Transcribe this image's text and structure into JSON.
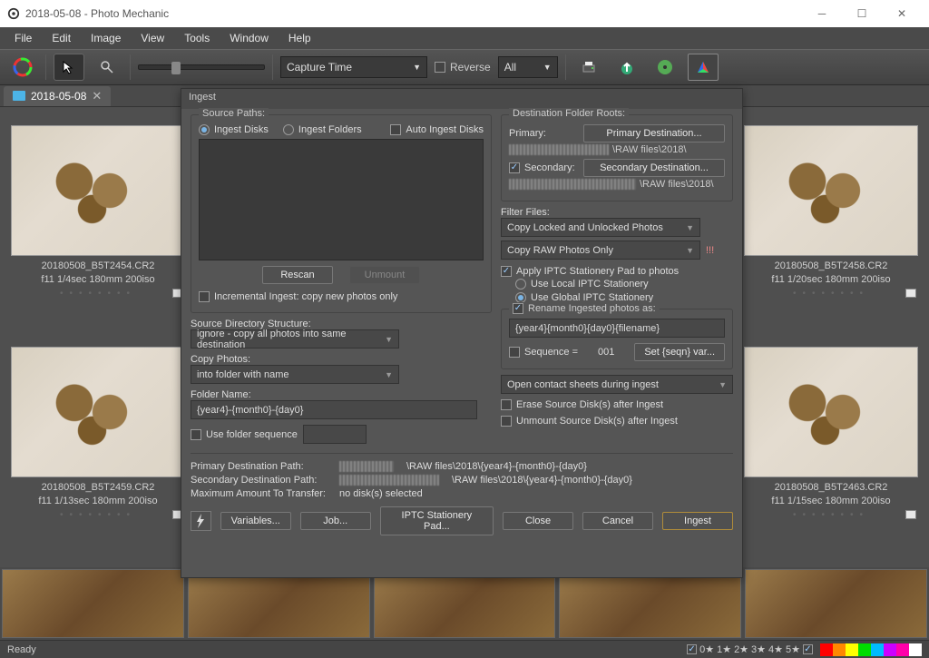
{
  "window": {
    "title": "2018-05-08 - Photo Mechanic"
  },
  "menu": [
    "File",
    "Edit",
    "Image",
    "View",
    "Tools",
    "Window",
    "Help"
  ],
  "toolbar": {
    "capture_sort": "Capture Time",
    "reverse": "Reverse",
    "filter": "All"
  },
  "tab": {
    "label": "2018-05-08"
  },
  "thumbs": [
    {
      "file": "20180508_B5T2454.CR2",
      "meta": "f11 1/4sec 180mm 200iso"
    },
    {
      "file": "20180508_B5T2458.CR2",
      "meta": "f11 1/20sec 180mm 200iso"
    },
    {
      "file": "20180508_B5T2459.CR2",
      "meta": "f11 1/13sec 180mm 200iso"
    },
    {
      "file": "20180508_B5T2463.CR2",
      "meta": "f11 1/15sec 180mm 200iso"
    }
  ],
  "dialog": {
    "title": "Ingest",
    "source": {
      "legend": "Source Paths:",
      "radio_disks": "Ingest Disks",
      "radio_folders": "Ingest Folders",
      "auto": "Auto Ingest Disks",
      "rescan": "Rescan",
      "unmount": "Unmount",
      "incremental": "Incremental Ingest: copy new photos only"
    },
    "dirstruct": {
      "label": "Source Directory Structure:",
      "value": "ignore - copy all photos into same destination"
    },
    "copyphotos": {
      "label": "Copy Photos:",
      "value": "into folder with name"
    },
    "foldername": {
      "label": "Folder Name:",
      "value": "{year4}-{month0}-{day0}"
    },
    "foldersequence": "Use folder sequence",
    "dest": {
      "legend": "Destination Folder Roots:",
      "primary_label": "Primary:",
      "primary_btn": "Primary Destination...",
      "primary_path": "\\RAW files\\2018\\",
      "secondary_label": "Secondary:",
      "secondary_btn": "Secondary Destination...",
      "secondary_path": "\\RAW files\\2018\\"
    },
    "filter": {
      "label": "Filter Files:",
      "opt1": "Copy Locked and Unlocked Photos",
      "opt2": "Copy RAW Photos Only",
      "bang": "!!!"
    },
    "iptc": {
      "apply": "Apply IPTC Stationery Pad to photos",
      "local": "Use Local IPTC Stationery",
      "global": "Use Global IPTC Stationery"
    },
    "rename": {
      "label": "Rename Ingested photos as:",
      "pattern": "{year4}{month0}{day0}{filename}",
      "seq": "Sequence =",
      "seqval": "001",
      "seqbtn": "Set {seqn} var..."
    },
    "contact": "Open contact sheets during ingest",
    "erase": "Erase Source Disk(s) after Ingest",
    "unmount_after": "Unmount Source Disk(s) after Ingest",
    "paths": {
      "primary_label": "Primary Destination Path:",
      "primary": "\\RAW files\\2018\\{year4}-{month0}-{day0}",
      "secondary_label": "Secondary Destination Path:",
      "secondary": "\\RAW files\\2018\\{year4}-{month0}-{day0}",
      "max_label": "Maximum Amount To Transfer:",
      "max": "no disk(s) selected"
    },
    "buttons": {
      "variables": "Variables...",
      "job": "Job...",
      "iptc": "IPTC Stationery Pad...",
      "close": "Close",
      "cancel": "Cancel",
      "ingest": "Ingest"
    }
  },
  "status": {
    "ready": "Ready",
    "ratings": [
      "0★",
      "1★",
      "2★",
      "3★",
      "4★",
      "5★"
    ],
    "colors": [
      "#ff0000",
      "#ff8800",
      "#ffff00",
      "#00dd00",
      "#00bbff",
      "#cc00ff",
      "#ff00aa",
      "#ffffff"
    ]
  }
}
